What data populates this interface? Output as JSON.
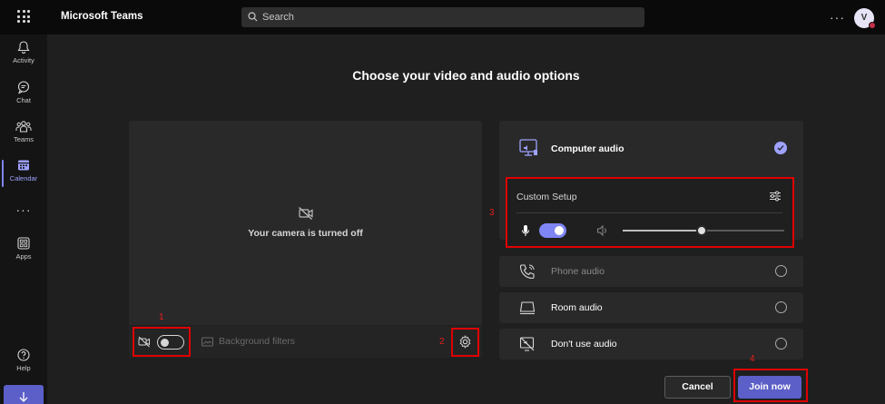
{
  "app": {
    "title": "Microsoft Teams"
  },
  "search": {
    "placeholder": "Search"
  },
  "user": {
    "avatar_initial": "V"
  },
  "rail": {
    "items": [
      {
        "label": "Activity",
        "icon": "bell-icon"
      },
      {
        "label": "Chat",
        "icon": "chat-icon"
      },
      {
        "label": "Teams",
        "icon": "teams-icon"
      },
      {
        "label": "Calendar",
        "icon": "calendar-icon",
        "active": true
      },
      {
        "label": "Apps",
        "icon": "apps-icon"
      },
      {
        "label": "Help",
        "icon": "help-icon"
      }
    ],
    "more": "···"
  },
  "prejoin": {
    "heading": "Choose your video and audio options",
    "camera_status": "Your camera is turned off",
    "camera_toggle_on": false,
    "background_filters": "Background filters"
  },
  "audio": {
    "options": [
      {
        "label": "Computer audio",
        "selected": true,
        "icon": "monitor-speaker-icon"
      },
      {
        "label": "Phone audio",
        "selected": false,
        "disabled": true,
        "icon": "phone-icon"
      },
      {
        "label": "Room audio",
        "selected": false,
        "icon": "room-icon"
      },
      {
        "label": "Don't use audio",
        "selected": false,
        "icon": "no-audio-icon"
      }
    ],
    "custom_setup_label": "Custom Setup",
    "mic_on": true,
    "speaker_volume": 0.5
  },
  "actions": {
    "cancel": "Cancel",
    "join": "Join now"
  },
  "annotations": [
    "1",
    "2",
    "3",
    "4"
  ],
  "colors": {
    "accent": "#5b5fc7",
    "accent_light": "#7f85f5",
    "annotation": "#e00000"
  }
}
